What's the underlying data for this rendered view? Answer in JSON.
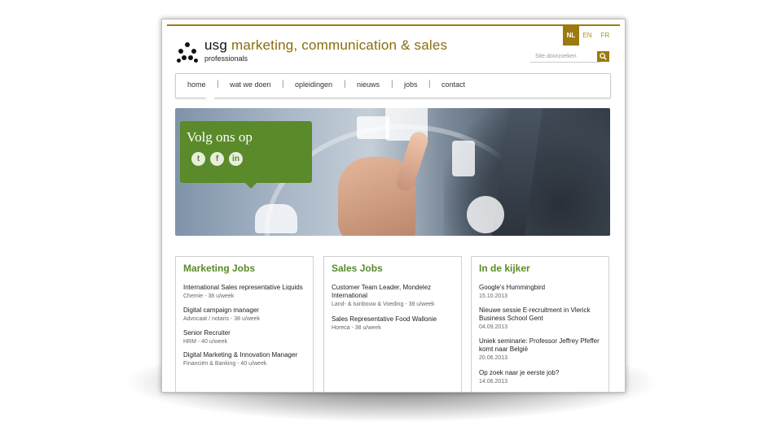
{
  "languages": [
    {
      "code": "NL",
      "active": true
    },
    {
      "code": "EN",
      "active": false
    },
    {
      "code": "FR",
      "active": false
    }
  ],
  "brand": {
    "name": "usg",
    "tagline": "marketing, communication & sales",
    "subtitle": "professionals"
  },
  "search": {
    "placeholder": "Site doorzoeken"
  },
  "nav": {
    "items": [
      "home",
      "wat we doen",
      "opleidingen",
      "nieuws",
      "jobs",
      "contact"
    ],
    "active": "home"
  },
  "banner": {
    "follow_title": "Volg ons op",
    "social": [
      "twitter",
      "facebook",
      "linkedin"
    ]
  },
  "sections": [
    {
      "title": "Marketing Jobs",
      "entries": [
        {
          "title": "International Sales representative Liquids",
          "meta": "Chemie - 38 u/week"
        },
        {
          "title": "Digital campaign manager",
          "meta": "Advocaat / notaris - 38 u/week"
        },
        {
          "title": "Senior Recruiter",
          "meta": "HRM - 40 u/week"
        },
        {
          "title": "Digital Marketing & Innovation Manager",
          "meta": "Financiën & Banking - 40 u/week"
        }
      ]
    },
    {
      "title": "Sales Jobs",
      "entries": [
        {
          "title": "Customer Team Leader, Mondelez International",
          "meta": "Land- & tuinbouw & Voeding - 38 u/week"
        },
        {
          "title": "Sales Representative Food Wallonie",
          "meta": "Horeca - 38 u/week"
        }
      ]
    },
    {
      "title": "In de kijker",
      "entries": [
        {
          "title": "Google's Hummingbird",
          "meta": "15.10.2013"
        },
        {
          "title": "Nieuwe sessie E-recruitment in Vlerick Business School Gent",
          "meta": "04.09.2013"
        },
        {
          "title": "Uniek seminarie: Professor Jeffrey Pfeffer komt naar België",
          "meta": "20.06.2013"
        },
        {
          "title": "Op zoek naar je eerste job?",
          "meta": "14.06.2013"
        }
      ]
    }
  ],
  "colors": {
    "brand_gold": "#9c7a10",
    "brand_green": "#5a8a2a"
  }
}
